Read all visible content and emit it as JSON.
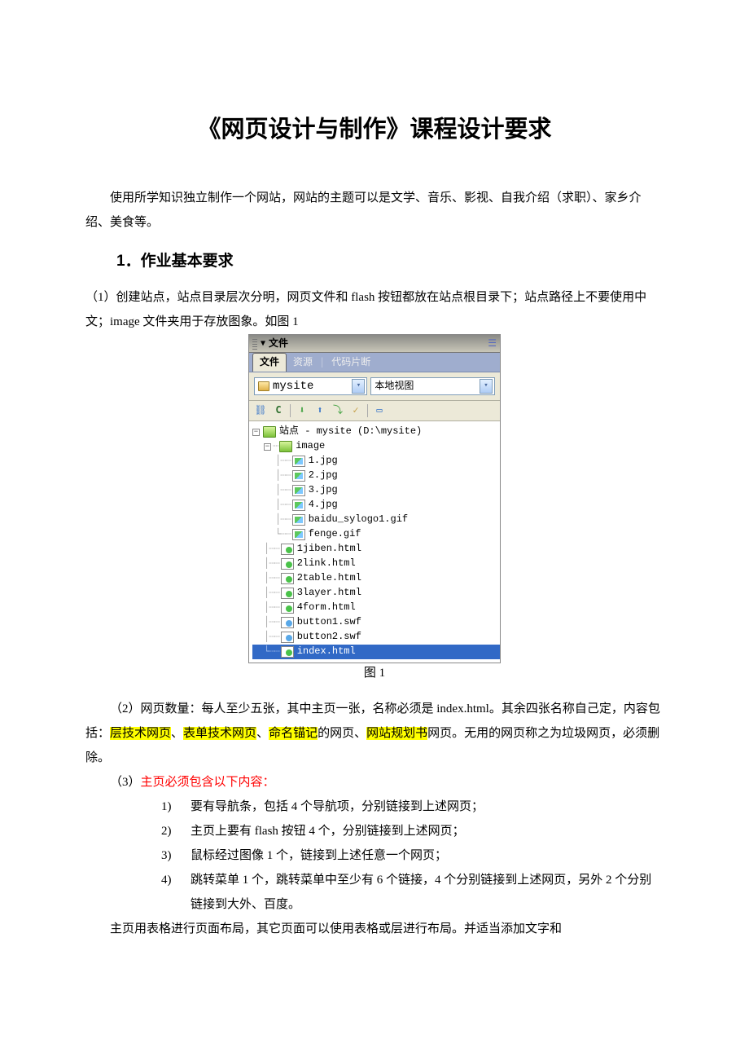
{
  "title": "《网页设计与制作》课程设计要求",
  "intro": "使用所学知识独立制作一个网站，网站的主题可以是文学、音乐、影视、自我介绍（求职）、家乡介绍、美食等。",
  "heading1": "1．作业基本要求",
  "p1": "（1）创建站点，站点目录层次分明，网页文件和 flash 按钮都放在站点根目录下；站点路径上不要使用中文；image 文件夹用于存放图象。如图 1",
  "panel": {
    "collapse_label": "文件",
    "tabs": {
      "active": "文件",
      "others": [
        "资源",
        "代码片断"
      ]
    },
    "dd_site": "mysite",
    "dd_view": "本地视图",
    "tree_root": "站点 - mysite (D:\\mysite)",
    "image_folder": "image",
    "imgs": [
      "1.jpg",
      "2.jpg",
      "3.jpg",
      "4.jpg",
      "baidu_sylogo1.gif",
      "fenge.gif"
    ],
    "htmls": [
      "1jiben.html",
      "2link.html",
      "2table.html",
      "3layer.html",
      "4form.html"
    ],
    "swfs": [
      "button1.swf",
      "button2.swf"
    ],
    "selected": "index.html"
  },
  "caption": "图 1",
  "p2_before": "（2）网页数量：每人至少五张，其中主页一张，名称必须是 index.html。其余四张名称自己定，内容包括：",
  "p2_hl1": "层技术网页",
  "p2_sep1": "、",
  "p2_hl2": "表单技术网页",
  "p2_sep2": "、",
  "p2_hl3": "命名锚记",
  "p2_mid": "的网页、",
  "p2_hl4": "网站规划书",
  "p2_after": "网页。无用的网页称之为垃圾网页，必须删除。",
  "p3_lead": "（3）",
  "p3_red": "主页必须包含以下内容：",
  "items": {
    "n1": "1)",
    "t1": "要有导航条，包括 4 个导航项，分别链接到上述网页；",
    "n2": "2)",
    "t2": "主页上要有 flash 按钮 4 个，分别链接到上述网页；",
    "n3": "3)",
    "t3": "鼠标经过图像 1 个，链接到上述任意一个网页；",
    "n4": "4)",
    "t4": "跳转菜单 1 个，跳转菜单中至少有 6 个链接，4 个分别链接到上述网页，另外 2 个分别链接到大外、百度。"
  },
  "p4": "主页用表格进行页面布局，其它页面可以使用表格或层进行布局。并适当添加文字和"
}
